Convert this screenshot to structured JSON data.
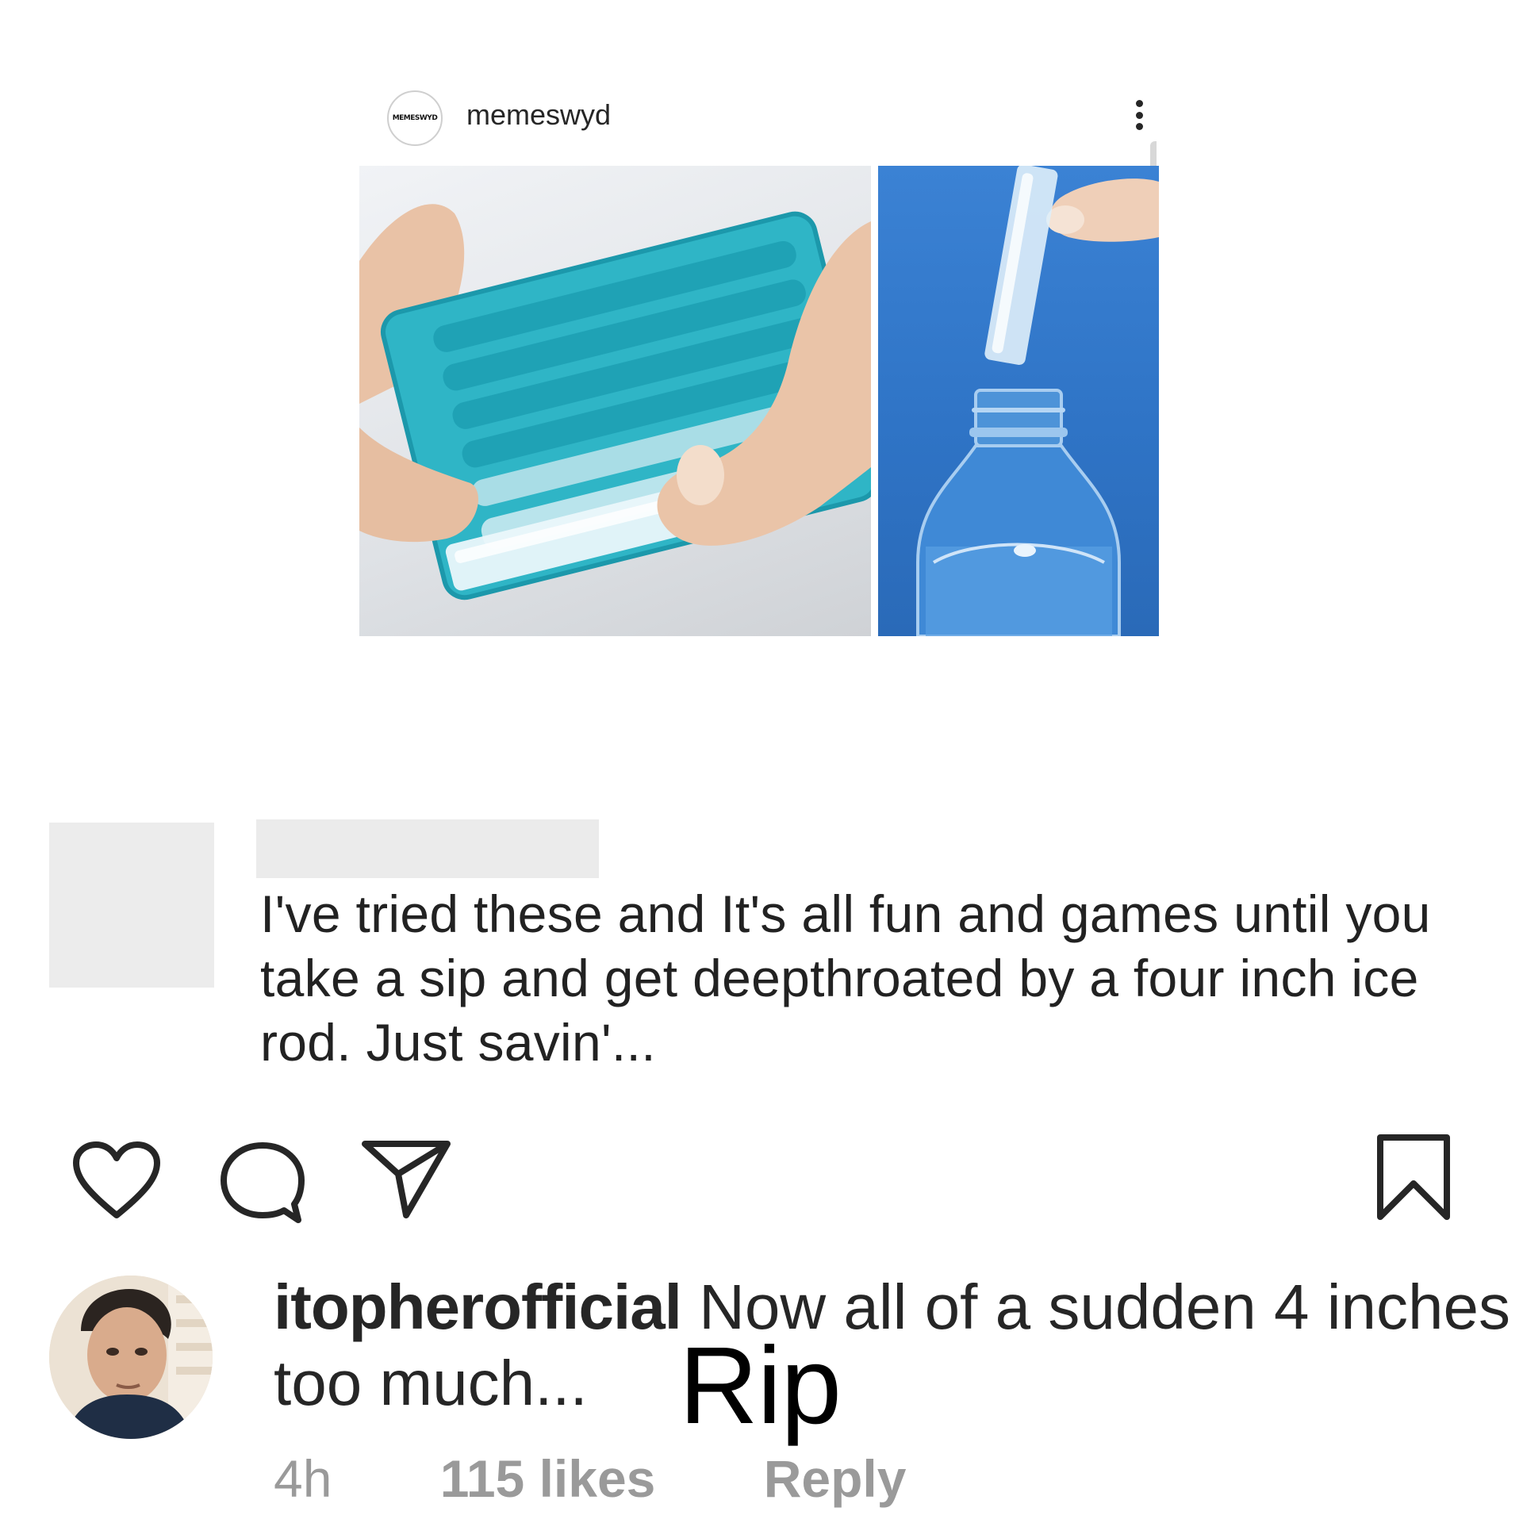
{
  "post": {
    "avatar_text": "MEMESWYD",
    "username": "memeswyd",
    "left_image": "ice-stick-tray-photo",
    "right_image": "ice-stick-bottle-photo"
  },
  "quoted_comment": {
    "text": "I've tried these and It's all fun and games until you take a sip and get deepthroated by a four inch ice rod. Just savin'..."
  },
  "actions": {
    "like_icon": "heart-outline",
    "comment_icon": "speech-bubble-outline",
    "share_icon": "paper-plane-outline",
    "save_icon": "bookmark-outline"
  },
  "comment": {
    "username": "itopherofficial",
    "text": "Now all of a sudden 4 inches too much...",
    "overlay": "Rip",
    "time": "4h",
    "likes": "115 likes",
    "reply": "Reply"
  },
  "colors": {
    "tray": "#2fb5c6",
    "bottle_bg": "#2f74c6",
    "meta_text": "#9a9a9a"
  }
}
